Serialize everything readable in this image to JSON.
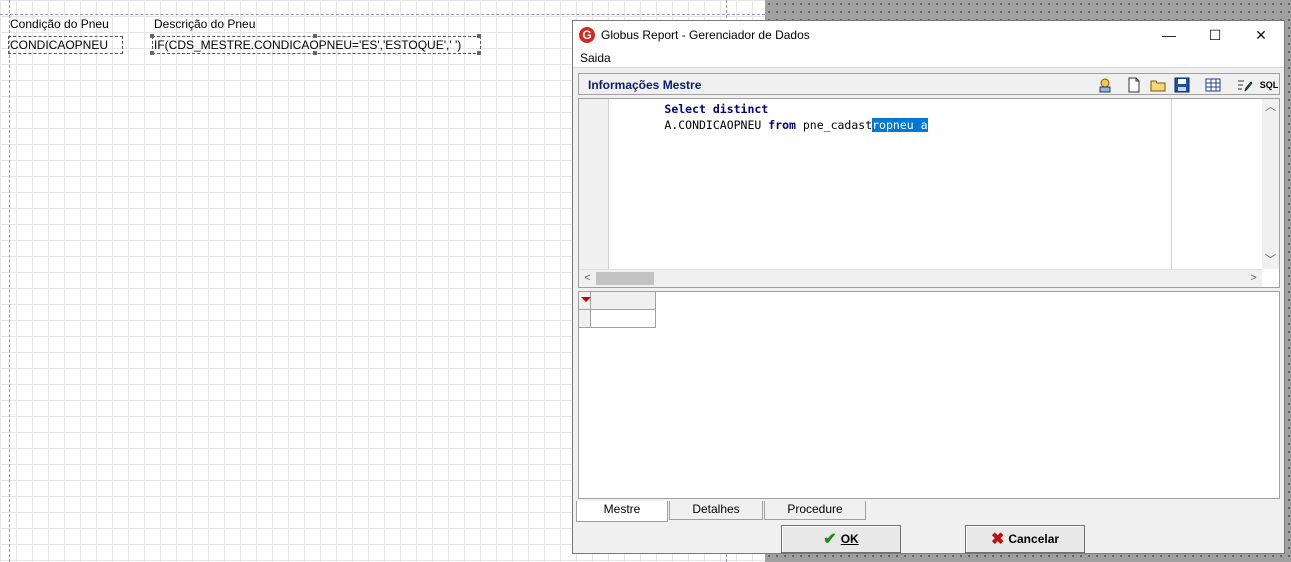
{
  "report": {
    "header_labels": [
      "Condição do Pneu",
      "Descrição do Pneu"
    ],
    "detail_fields": [
      "CONDICAOPNEU",
      "IF(CDS_MESTRE.CONDICAOPNEU='ES','ESTOQUE',' ')"
    ]
  },
  "window": {
    "title": "Globus Report - Gerenciador de Dados",
    "app_icon": "G",
    "controls": {
      "minimize": "—",
      "maximize": "☐",
      "close": "✕"
    }
  },
  "menu": {
    "items": [
      "Saida"
    ]
  },
  "panel": {
    "title": "Informações Mestre",
    "toolbar": [
      "wizard-icon",
      "new-document-icon",
      "open-folder-icon",
      "save-disk-icon",
      "grid-view-icon",
      "edit-icon",
      "sql-icon"
    ],
    "sql_label": "SQL"
  },
  "editor": {
    "line1_keyword": "Select distinct",
    "line2_prefix": "        A.CONDICAOPNEU ",
    "line2_keyword": "from",
    "line2_text": " pne_cadast",
    "line2_selected": "ropneu a"
  },
  "tabs": [
    {
      "label": "Mestre",
      "active": true
    },
    {
      "label": "Detalhes",
      "active": false
    },
    {
      "label": "Procedure",
      "active": false
    }
  ],
  "buttons": {
    "ok_label": "OK",
    "cancel_label": "Cancelar"
  },
  "colors": {
    "accent_title": "#0a1e6e",
    "selection": "#0078d7",
    "ok_icon": "#1a8a1a",
    "cancel_icon": "#c01010"
  }
}
